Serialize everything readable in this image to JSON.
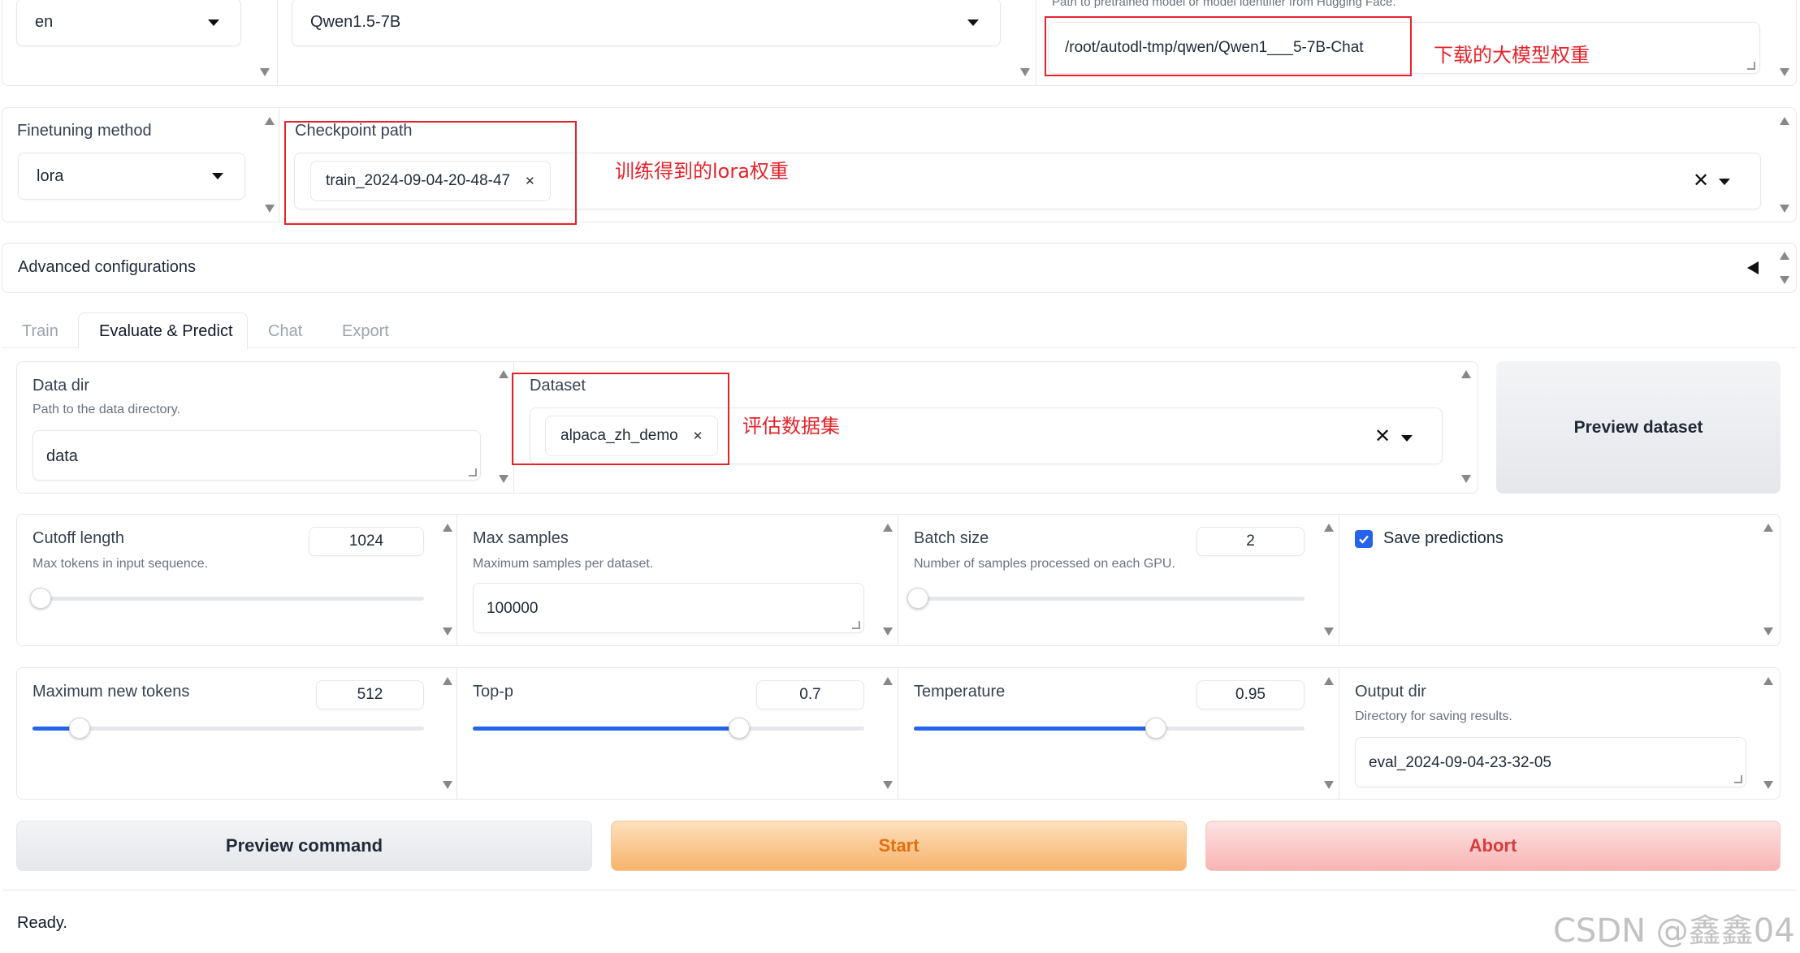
{
  "top": {
    "language": "en",
    "model_name": "Qwen1.5-7B",
    "model_path_info": "Path to pretrained model or model identifier from Hugging Face.",
    "model_path": "/root/autodl-tmp/qwen/Qwen1___5-7B-Chat",
    "annotation_model": "下载的大模型权重"
  },
  "finetune": {
    "method_label": "Finetuning method",
    "method": "lora",
    "checkpoint_label": "Checkpoint path",
    "checkpoint": "train_2024-09-04-20-48-47",
    "annotation_checkpoint": "训练得到的lora权重"
  },
  "advanced": {
    "label": "Advanced configurations"
  },
  "tabs": [
    "Train",
    "Evaluate & Predict",
    "Chat",
    "Export"
  ],
  "active_tab": "Evaluate & Predict",
  "data": {
    "dir_label": "Data dir",
    "dir_info": "Path to the data directory.",
    "dir_value": "data",
    "dataset_label": "Dataset",
    "dataset": "alpaca_zh_demo",
    "annotation_dataset": "评估数据集",
    "preview_dataset": "Preview dataset"
  },
  "params": {
    "cutoff_label": "Cutoff length",
    "cutoff_info": "Max tokens in input sequence.",
    "cutoff_value": "1024",
    "cutoff_fraction": 0.02,
    "max_samples_label": "Max samples",
    "max_samples_info": "Maximum samples per dataset.",
    "max_samples_value": "100000",
    "batch_label": "Batch size",
    "batch_info": "Number of samples processed on each GPU.",
    "batch_value": "2",
    "batch_fraction": 0.01,
    "save_predictions_label": "Save predictions",
    "save_predictions": true
  },
  "gen": {
    "max_new_label": "Maximum new tokens",
    "max_new_value": "512",
    "max_new_fraction": 0.12,
    "topp_label": "Top-p",
    "topp_value": "0.7",
    "topp_fraction": 0.68,
    "temp_label": "Temperature",
    "temp_value": "0.95",
    "temp_fraction": 0.62,
    "output_label": "Output dir",
    "output_info": "Directory for saving results.",
    "output_value": "eval_2024-09-04-23-32-05"
  },
  "buttons": {
    "preview_command": "Preview command",
    "start": "Start",
    "abort": "Abort"
  },
  "status": "Ready.",
  "watermark": "CSDN @鑫鑫04",
  "colors": {
    "accent_blue": "#2563eb",
    "start_orange": "#f5a04a",
    "abort_red": "#d63b3b",
    "annotation_red": "#e6232b"
  }
}
